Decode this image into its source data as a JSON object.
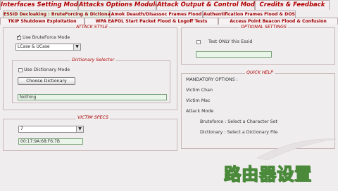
{
  "tabs": [
    {
      "label": "Interfaces Setting Module"
    },
    {
      "label": "Attacks Options Modules"
    },
    {
      "label": "Attack Output & Control Module"
    },
    {
      "label": "Credits & Feedback"
    }
  ],
  "subtabs_row1": [
    {
      "label": "ESSID Decloaking : BruteForcing & Dictionary"
    },
    {
      "label": "Amok Deauth/Disassoc Frames Flood"
    },
    {
      "label": "Authentification Frames Flood & DOS"
    }
  ],
  "subtabs_row2": [
    {
      "label": "TKIP Shutdown Exploitation"
    },
    {
      "label": "WPA EAPOL Start Packet Flood & Logoff Tests"
    },
    {
      "label": "Access Point Beacon Flood & Confusion"
    }
  ],
  "attack_style": {
    "legend": "ATTACK STYLE",
    "bruteforce_label": "Use BruteForce Mode",
    "charset_value": "LCase & UCase",
    "dictionary_legend": "Dictionary Selector",
    "dictionary_mode_label": "Use Dictionary Mode",
    "choose_button": "Choose Dictionary",
    "dictionary_value": "Nothing"
  },
  "optional": {
    "legend": "OPTIONAL SETTINGS",
    "test_label": "Test ONLY this Essid",
    "essid_value": ""
  },
  "victim": {
    "legend": "VICTIM SPECS",
    "chan_value": "7",
    "mac_value": "00:17:9A:68:F6:7B"
  },
  "help": {
    "legend": "QUICK HELP",
    "lines": [
      "MANDATORY OPTIONS :",
      "Victim Chan",
      "Victim Mac",
      "Attack Mode",
      "Bruteforce :    Select a Character Set",
      "Dictionary : Select a Dictionary File"
    ]
  },
  "watermark": "路由器设置"
}
